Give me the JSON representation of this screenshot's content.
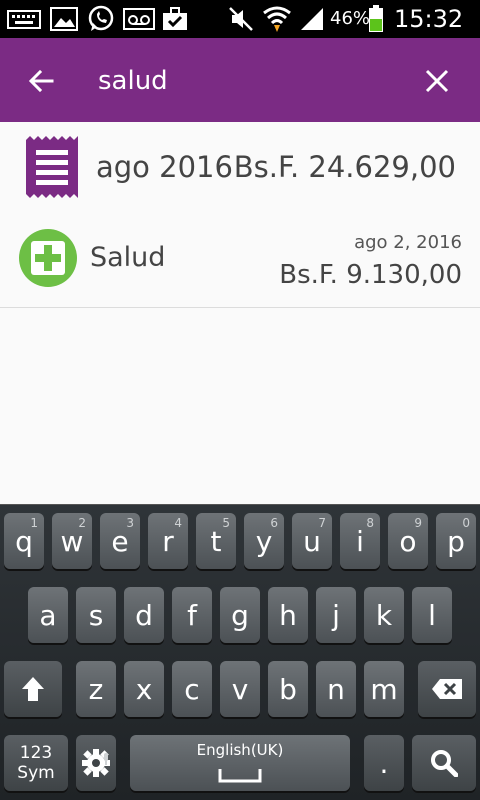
{
  "status_bar": {
    "battery_percent": "46%",
    "time": "15:32"
  },
  "app_bar": {
    "search_value": "salud"
  },
  "results": [
    {
      "title": "ago 2016",
      "amount": "Bs.F. 24.629,00",
      "icon": "receipt-icon"
    },
    {
      "title": "Salud",
      "date": "ago 2, 2016",
      "amount": "Bs.F. 9.130,00",
      "icon": "plus-icon"
    }
  ],
  "keyboard": {
    "row1": [
      {
        "k": "q",
        "h": "1"
      },
      {
        "k": "w",
        "h": "2"
      },
      {
        "k": "e",
        "h": "3"
      },
      {
        "k": "r",
        "h": "4"
      },
      {
        "k": "t",
        "h": "5"
      },
      {
        "k": "y",
        "h": "6"
      },
      {
        "k": "u",
        "h": "7"
      },
      {
        "k": "i",
        "h": "8"
      },
      {
        "k": "o",
        "h": "9"
      },
      {
        "k": "p",
        "h": "0"
      }
    ],
    "row2": [
      "a",
      "s",
      "d",
      "f",
      "g",
      "h",
      "j",
      "k",
      "l"
    ],
    "row3": [
      "z",
      "x",
      "c",
      "v",
      "b",
      "n",
      "m"
    ],
    "sym_label_top": "123",
    "sym_label_bottom": "Sym",
    "space_label": "English(UK)",
    "period": "."
  },
  "colors": {
    "app_bar": "#7b2b84",
    "receipt_icon": "#7b2b84",
    "plus_icon": "#6dbf45"
  }
}
